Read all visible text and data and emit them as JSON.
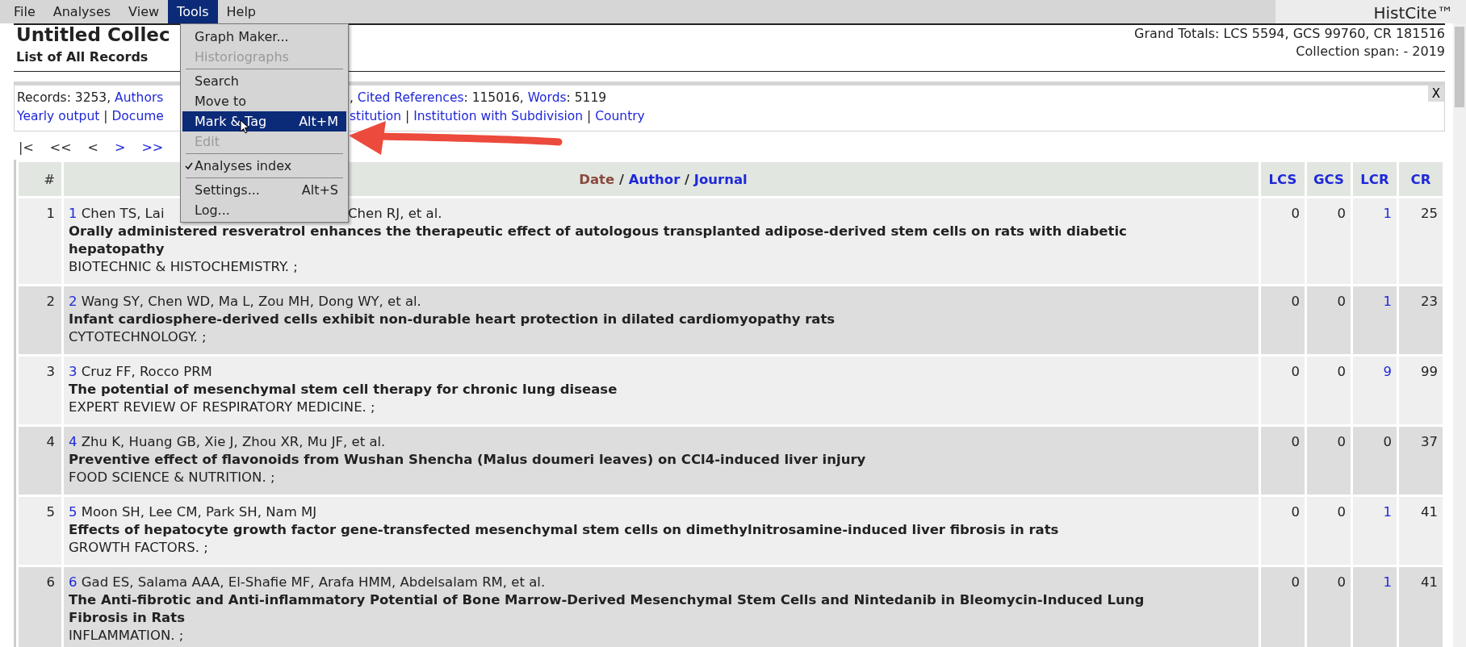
{
  "menu_bar": [
    {
      "label": "File",
      "selected": false
    },
    {
      "label": "Analyses",
      "selected": false
    },
    {
      "label": "View",
      "selected": false
    },
    {
      "label": "Tools",
      "selected": true
    },
    {
      "label": "Help",
      "selected": false
    }
  ],
  "app_title": "HistCite™",
  "tools_menu": [
    {
      "kind": "item",
      "label": "Graph Maker...",
      "disabled": false,
      "selected": false,
      "checked": false
    },
    {
      "kind": "item",
      "label": "Historiographs",
      "disabled": true,
      "selected": false,
      "checked": false
    },
    {
      "kind": "separator"
    },
    {
      "kind": "item",
      "label": "Search",
      "disabled": false,
      "selected": false,
      "checked": false
    },
    {
      "kind": "item",
      "label": "Move to",
      "disabled": false,
      "selected": false,
      "checked": false
    },
    {
      "kind": "item",
      "label": "Mark & Tag",
      "shortcut": "Alt+M",
      "disabled": false,
      "selected": true,
      "checked": false
    },
    {
      "kind": "item",
      "label": "Edit",
      "disabled": true,
      "selected": false,
      "checked": false
    },
    {
      "kind": "separator"
    },
    {
      "kind": "item",
      "label": "Analyses index",
      "disabled": false,
      "selected": false,
      "checked": true
    },
    {
      "kind": "separator"
    },
    {
      "kind": "item",
      "label": "Settings...",
      "shortcut": "Alt+S",
      "disabled": false,
      "selected": false,
      "checked": false
    },
    {
      "kind": "item",
      "label": "Log...",
      "disabled": false,
      "selected": false,
      "checked": false
    }
  ],
  "collection": {
    "title": "Untitled Collec",
    "subtitle": "List of All Records",
    "grand_totals": "Grand Totals: LCS 5594, GCS 99760, CR 181516",
    "span": "Collection span: - 2019"
  },
  "info_box": {
    "lines": [
      {
        "left": [
          {
            "text": "Records: 3253, ",
            "link": false
          },
          {
            "text": "Authors",
            "link": true
          }
        ],
        "right_prefix": ", ",
        "right": [
          {
            "text": "Cited References",
            "link": true
          },
          {
            "text": ": 115016, ",
            "link": false
          },
          {
            "text": "Words",
            "link": true
          },
          {
            "text": ": 5119",
            "link": false
          }
        ]
      },
      {
        "left": [
          {
            "text": "Yearly output",
            "link": true
          },
          {
            "text": " | ",
            "link": false
          },
          {
            "text": "Docume",
            "link": true
          }
        ],
        "right": [
          {
            "text": "stitution",
            "link": true
          },
          {
            "text": " | ",
            "link": false
          },
          {
            "text": "Institution with Subdivision",
            "link": true
          },
          {
            "text": " | ",
            "link": false
          },
          {
            "text": "Country",
            "link": true
          }
        ]
      }
    ],
    "close": "X"
  },
  "pager": [
    {
      "label": "|<",
      "enabled": false
    },
    {
      "label": "<<",
      "enabled": false
    },
    {
      "label": "<",
      "enabled": false
    },
    {
      "label": ">",
      "enabled": true
    },
    {
      "label": ">>",
      "enabled": true
    }
  ],
  "table": {
    "columns": [
      {
        "kind": "index",
        "parts": [
          {
            "text": "#",
            "kind": "plain"
          }
        ]
      },
      {
        "kind": "main",
        "parts": [
          {
            "text": "Date",
            "kind": "sorted"
          },
          {
            "text": " / ",
            "kind": "plain"
          },
          {
            "text": "Author",
            "kind": "link"
          },
          {
            "text": " / ",
            "kind": "plain"
          },
          {
            "text": "Journal",
            "kind": "link"
          }
        ]
      },
      {
        "kind": "num",
        "parts": [
          {
            "text": "LCS",
            "kind": "link"
          }
        ]
      },
      {
        "kind": "num",
        "parts": [
          {
            "text": "GCS",
            "kind": "link"
          }
        ]
      },
      {
        "kind": "num",
        "parts": [
          {
            "text": "LCR",
            "kind": "link"
          }
        ]
      },
      {
        "kind": "num",
        "parts": [
          {
            "text": "CR",
            "kind": "link"
          }
        ]
      }
    ],
    "rows": [
      {
        "index": "1",
        "number": "1",
        "authors": [
          "Chen TS, Lai",
          "Chen RJ, et al."
        ],
        "title": "Orally administered resveratrol enhances the therapeutic effect of autologous transplanted adipose-derived stem cells on rats with diabetic hepatopathy",
        "journal": "BIOTECHNIC & HISTOCHEMISTRY. ;",
        "lcs": "0",
        "gcs": "0",
        "lcr": "1",
        "lcr_linked": true,
        "cr": "25"
      },
      {
        "index": "2",
        "number": "2",
        "authors": [
          "Wang SY, Chen WD, Ma L, Zou MH, Dong WY, et al."
        ],
        "title": "Infant cardiosphere-derived cells exhibit non-durable heart protection in dilated cardiomyopathy rats",
        "journal": "CYTOTECHNOLOGY. ;",
        "lcs": "0",
        "gcs": "0",
        "lcr": "1",
        "lcr_linked": true,
        "cr": "23"
      },
      {
        "index": "3",
        "number": "3",
        "authors": [
          "Cruz FF, Rocco PRM"
        ],
        "title": "The potential of mesenchymal stem cell therapy for chronic lung disease",
        "journal": "EXPERT REVIEW OF RESPIRATORY MEDICINE. ;",
        "lcs": "0",
        "gcs": "0",
        "lcr": "9",
        "lcr_linked": true,
        "cr": "99"
      },
      {
        "index": "4",
        "number": "4",
        "authors": [
          "Zhu K, Huang GB, Xie J, Zhou XR, Mu JF, et al."
        ],
        "title": "Preventive effect of flavonoids from Wushan Shencha (Malus doumeri leaves) on CCl4-induced liver injury",
        "journal": "FOOD SCIENCE & NUTRITION. ;",
        "lcs": "0",
        "gcs": "0",
        "lcr": "0",
        "lcr_linked": false,
        "cr": "37"
      },
      {
        "index": "5",
        "number": "5",
        "authors": [
          "Moon SH, Lee CM, Park SH, Nam MJ"
        ],
        "title": "Effects of hepatocyte growth factor gene-transfected mesenchymal stem cells on dimethylnitrosamine-induced liver fibrosis in rats",
        "journal": "GROWTH FACTORS. ;",
        "lcs": "0",
        "gcs": "0",
        "lcr": "1",
        "lcr_linked": true,
        "cr": "41"
      },
      {
        "index": "6",
        "number": "6",
        "authors": [
          "Gad ES, Salama AAA, El-Shafie MF, Arafa HMM, Abdelsalam RM, et al."
        ],
        "title": "The Anti-fibrotic and Anti-inflammatory Potential of Bone Marrow-Derived Mesenchymal Stem Cells and Nintedanib in Bleomycin-Induced Lung Fibrosis in Rats",
        "journal": "INFLAMMATION. ;",
        "lcs": "0",
        "gcs": "0",
        "lcr": "1",
        "lcr_linked": true,
        "cr": "41"
      }
    ]
  }
}
